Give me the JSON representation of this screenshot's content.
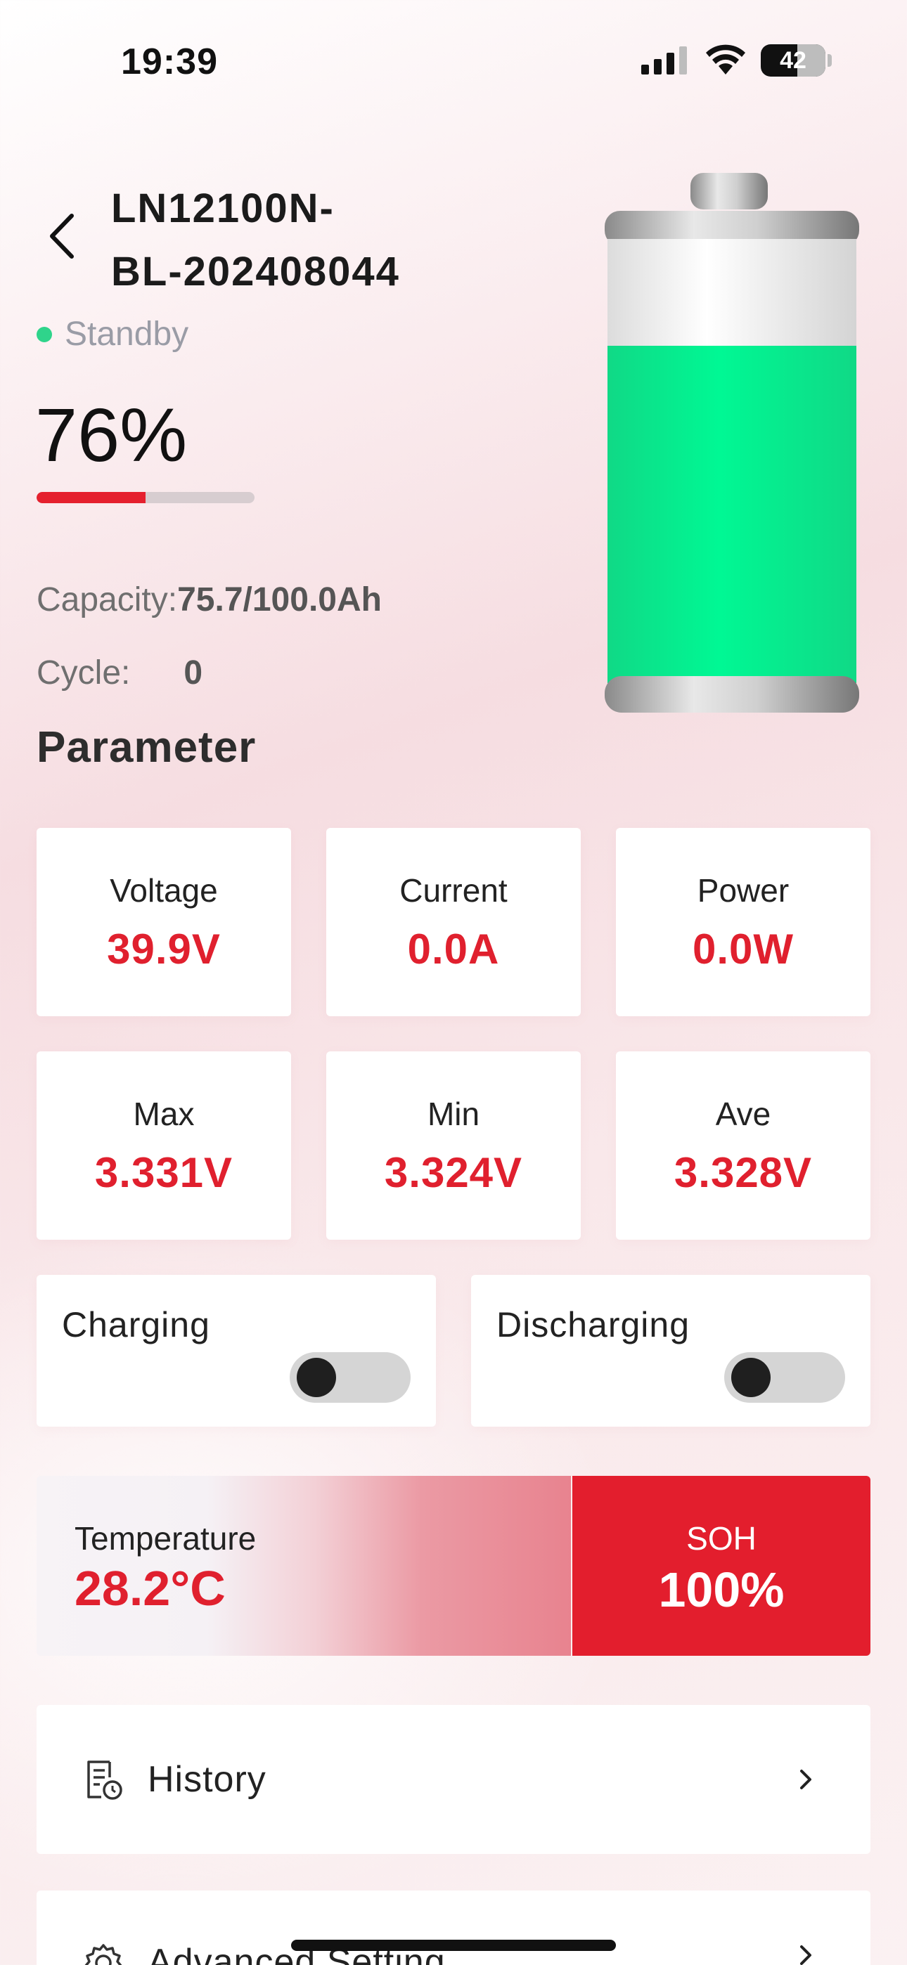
{
  "status_bar": {
    "time": "19:39",
    "battery_level": "42"
  },
  "header": {
    "title_line1": "LN12100N-",
    "title_line2": "BL-202408044",
    "status": "Standby",
    "status_color": "#2fd48b"
  },
  "battery": {
    "percent_label": "76%",
    "percent_value": 0.5,
    "capacity_label": "Capacity:",
    "capacity_value": "75.7/100.0Ah",
    "cycle_label": "Cycle:",
    "cycle_value": "0",
    "fill_color": "#00f08f"
  },
  "parameter": {
    "section_title": "Parameter",
    "metrics": [
      {
        "label": "Voltage",
        "value": "39.9V"
      },
      {
        "label": "Current",
        "value": "0.0A"
      },
      {
        "label": "Power",
        "value": "0.0W"
      },
      {
        "label": "Max",
        "value": "3.331V"
      },
      {
        "label": "Min",
        "value": "3.324V"
      },
      {
        "label": "Ave",
        "value": "3.328V"
      }
    ]
  },
  "toggles": {
    "charging": {
      "label": "Charging",
      "on": false
    },
    "discharging": {
      "label": "Discharging",
      "on": false
    }
  },
  "temperature": {
    "label": "Temperature",
    "value": "28.2°C"
  },
  "soh": {
    "label": "SOH",
    "value": "100%"
  },
  "menu": {
    "history": "History",
    "advanced": "Advanced Setting"
  },
  "colors": {
    "accent": "#e31e2d",
    "value_red": "#e0202e"
  }
}
